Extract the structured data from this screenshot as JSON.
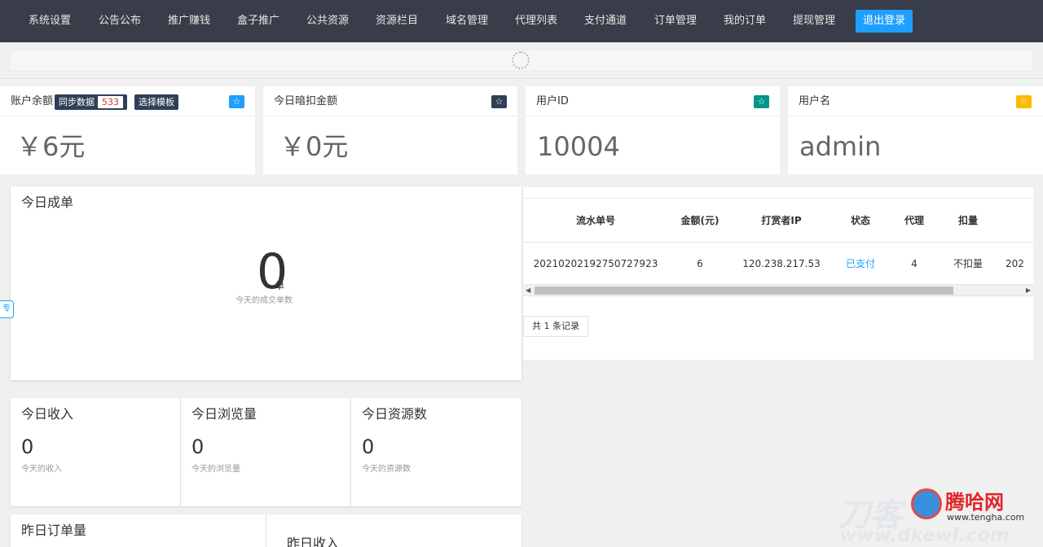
{
  "nav": {
    "items": [
      "系统设置",
      "公告公布",
      "推广赚钱",
      "盒子推广",
      "公共资源",
      "资源栏目",
      "域名管理",
      "代理列表",
      "支付通道",
      "订单管理",
      "我的订单",
      "提现管理"
    ],
    "logout": "退出登录"
  },
  "stats": {
    "balance": {
      "title": "账户余额",
      "sync_label": "同步数据",
      "sync_count": "533",
      "template_label": "选择模板",
      "value": "￥6元"
    },
    "deduct": {
      "title": "今日暗扣金额",
      "value": "￥0元"
    },
    "userid": {
      "title": "用户ID",
      "value": "10004"
    },
    "username": {
      "title": "用户名",
      "value": "admin"
    },
    "star_glyph": "☆"
  },
  "today_orders": {
    "title": "今日成单",
    "value": "0",
    "unit": "单",
    "sub": "今天的成交单数"
  },
  "side_tab": "专",
  "orders_table": {
    "headers": [
      "流水单号",
      "金额(元)",
      "打赏者IP",
      "状态",
      "代理",
      "扣量"
    ],
    "rows": [
      {
        "serial": "20210202192750727923",
        "amount": "6",
        "ip": "120.238.217.53",
        "status": "已支付",
        "agent": "4",
        "deduct": "不扣量",
        "extra": "202"
      }
    ],
    "total": "共 1 条记录"
  },
  "tiles": [
    {
      "title": "今日收入",
      "value": "0",
      "sub": "今天的收入"
    },
    {
      "title": "今日浏览量",
      "value": "0",
      "sub": "今天的浏览量"
    },
    {
      "title": "今日资源数",
      "value": "0",
      "sub": "今天的资源数"
    }
  ],
  "yesterday": {
    "orders_title": "昨日订单量",
    "income_title": "昨日收入"
  },
  "watermark": {
    "brand": "腾哈网",
    "url": "www.tengha.com",
    "left": "刀客",
    "site": "www.dkewl.com"
  },
  "colors": {
    "nav_bg": "#393d49",
    "accent": "#1e9fff",
    "star_blue": "#1e9fff",
    "star_dark": "#2f4056",
    "star_green": "#009688",
    "star_yellow": "#ffb800"
  }
}
